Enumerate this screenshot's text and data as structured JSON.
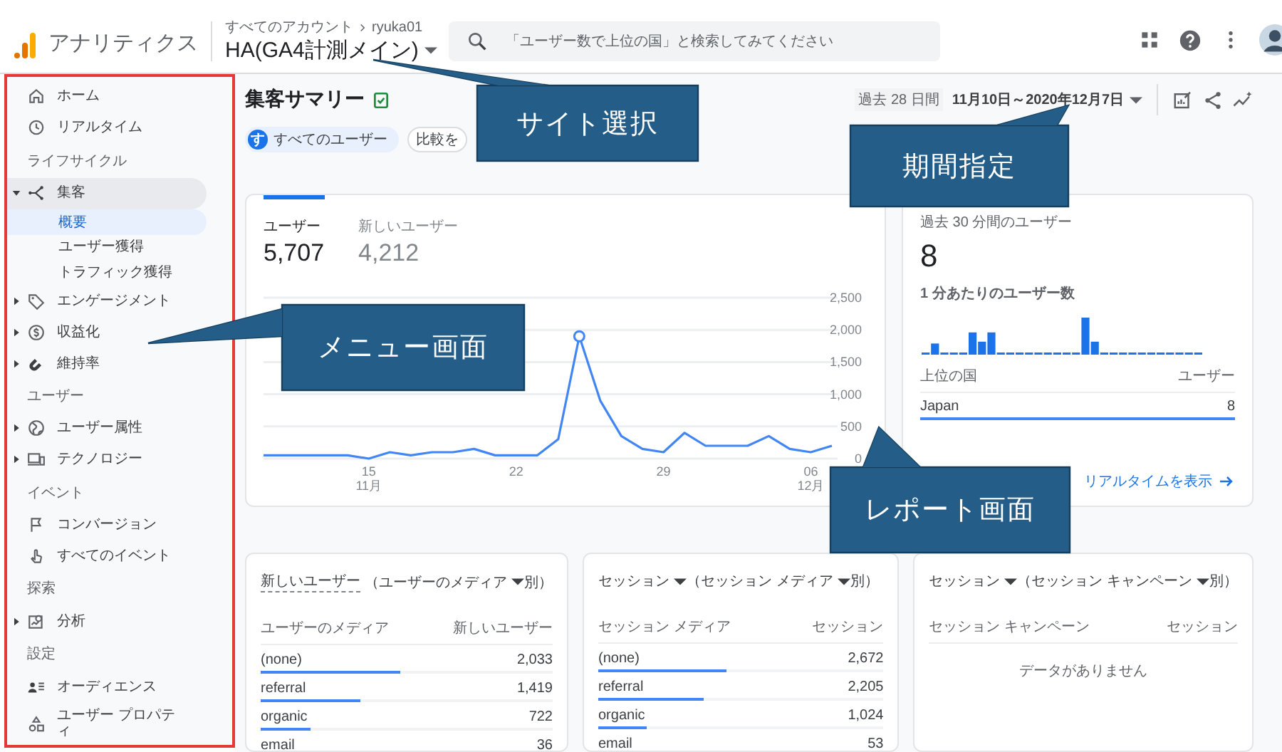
{
  "top_bar": {
    "product": "アナリティクス",
    "breadcrumb": [
      "すべてのアカウント",
      "ryuka01"
    ],
    "property": "HA(GA4計測メイン)",
    "search": {
      "placeholder": "「ユーザー数で上位の国」と検索してみてください"
    }
  },
  "sidebar": {
    "sections": [
      {
        "items": [
          {
            "label": "ホーム",
            "kind": "link",
            "selected": false,
            "expanded": false
          },
          {
            "label": "リアルタイム",
            "kind": "link",
            "selected": false,
            "expanded": false
          }
        ]
      },
      {
        "heading": "ライフサイクル",
        "items": [
          {
            "label": "集客",
            "kind": "group",
            "selected": false,
            "expanded": true,
            "children": [
              {
                "label": "概要",
                "selected": true
              },
              {
                "label": "ユーザー獲得",
                "selected": false
              },
              {
                "label": "トラフィック獲得",
                "selected": false
              }
            ]
          },
          {
            "label": "エンゲージメント",
            "kind": "group",
            "selected": false,
            "expanded": false
          },
          {
            "label": "収益化",
            "kind": "group",
            "selected": false,
            "expanded": false
          },
          {
            "label": "維持率",
            "kind": "group",
            "selected": false,
            "expanded": false
          }
        ]
      },
      {
        "heading": "ユーザー",
        "items": [
          {
            "label": "ユーザー属性",
            "kind": "group",
            "selected": false,
            "expanded": false
          },
          {
            "label": "テクノロジー",
            "kind": "group",
            "selected": false,
            "expanded": false
          }
        ]
      },
      {
        "heading": "イベント",
        "items": [
          {
            "label": "コンバージョン",
            "kind": "link",
            "selected": false,
            "expanded": false
          },
          {
            "label": "すべてのイベント",
            "kind": "link",
            "selected": false,
            "expanded": false
          }
        ]
      },
      {
        "heading": "探索",
        "items": [
          {
            "label": "分析",
            "kind": "group",
            "selected": false,
            "expanded": false
          }
        ]
      },
      {
        "heading": "設定",
        "items": [
          {
            "label": "オーディエンス",
            "kind": "link",
            "selected": false,
            "expanded": false
          },
          {
            "label": "ユーザー プロパティ",
            "kind": "link",
            "selected": false,
            "expanded": false
          }
        ]
      }
    ]
  },
  "report": {
    "title": "集客サマリー",
    "date_range": {
      "preset": "過去 28 日間",
      "range": "11月10日～2020年12月7日"
    },
    "chips": [
      {
        "kind": "segment",
        "avatar": "す",
        "label": "すべてのユーザー"
      },
      {
        "kind": "compare",
        "label": "比較を"
      }
    ]
  },
  "trend_card": {
    "tabs": [
      {
        "label": "ユーザー",
        "value": "5,707",
        "selected": true
      },
      {
        "label": "新しいユーザー",
        "value": "4,212",
        "selected": false
      }
    ],
    "chart_data": {
      "type": "line",
      "grid": true,
      "categories": [
        null,
        null,
        null,
        null,
        null,
        "15\n11月",
        null,
        null,
        null,
        null,
        null,
        null,
        "22",
        null,
        null,
        null,
        null,
        null,
        null,
        "29",
        null,
        null,
        null,
        null,
        null,
        null,
        "06\n12月",
        null
      ],
      "ylim": [
        0,
        2500
      ],
      "yticks": [
        {
          "value": 0,
          "label": "0"
        },
        {
          "value": 500,
          "label": "500"
        },
        {
          "value": 1000,
          "label": "1,000"
        },
        {
          "value": 1500,
          "label": "1,500"
        },
        {
          "value": 2000,
          "label": "2,000"
        },
        {
          "value": 2500,
          "label": "2,500"
        }
      ],
      "series": [
        {
          "color": "#4285f4",
          "values": [
            50,
            50,
            50,
            50,
            50,
            0,
            100,
            50,
            100,
            100,
            150,
            50,
            50,
            50,
            300,
            1900,
            900,
            350,
            150,
            100,
            400,
            200,
            200,
            200,
            350,
            150,
            100,
            200
          ]
        }
      ]
    }
  },
  "realtime_card": {
    "title": "過去 30 分間のユーザー",
    "value": "8",
    "subtitle": "1 分あたりのユーザー数",
    "columns": [
      "上位の国",
      "ユーザー"
    ],
    "rows": [
      {
        "label": "Japan",
        "value": "8",
        "level": 1
      }
    ],
    "link": "リアルタイムを表示"
  },
  "table_cards": [
    {
      "title_parts": [
        {
          "text": "新しいユーザー",
          "dropdown": false,
          "underlined": true
        },
        {
          "text": "（ユーザーのメディア",
          "dropdown": true,
          "underlined": false
        },
        {
          "text": "別）",
          "dropdown": false,
          "underlined": false
        }
      ],
      "columns": [
        "ユーザーのメディア",
        "新しいユーザー"
      ],
      "rows": [
        {
          "label": "(none)",
          "value": "2,033",
          "level": 0.48
        },
        {
          "label": "referral",
          "value": "1,419",
          "level": 0.34
        },
        {
          "label": "organic",
          "value": "722",
          "level": 0.17
        },
        {
          "label": "email",
          "value": "36"
        }
      ]
    },
    {
      "title_parts": [
        {
          "text": "セッション",
          "dropdown": true,
          "underlined": false
        },
        {
          "text": "（セッション メディア",
          "dropdown": true,
          "underlined": false
        },
        {
          "text": "別）",
          "dropdown": false,
          "underlined": false
        }
      ],
      "columns": [
        "セッション メディア",
        "セッション"
      ],
      "rows": [
        {
          "label": "(none)",
          "value": "2,672",
          "level": 0.45
        },
        {
          "label": "referral",
          "value": "2,205",
          "level": 0.37
        },
        {
          "label": "organic",
          "value": "1,024",
          "level": 0.17
        },
        {
          "label": "email",
          "value": "53"
        }
      ]
    },
    {
      "title_parts": [
        {
          "text": "セッション",
          "dropdown": true,
          "underlined": false
        },
        {
          "text": "（セッション キャンペーン",
          "dropdown": true,
          "underlined": false
        },
        {
          "text": "別）",
          "dropdown": false,
          "underlined": false
        }
      ],
      "columns": [
        "セッション キャンペーン",
        "セッション"
      ],
      "empty_text": "データがありません"
    }
  ],
  "callouts": [
    {
      "text": "サイト選択"
    },
    {
      "text": "期間指定"
    },
    {
      "text": "メニュー画面"
    },
    {
      "text": "レポート画面"
    }
  ]
}
